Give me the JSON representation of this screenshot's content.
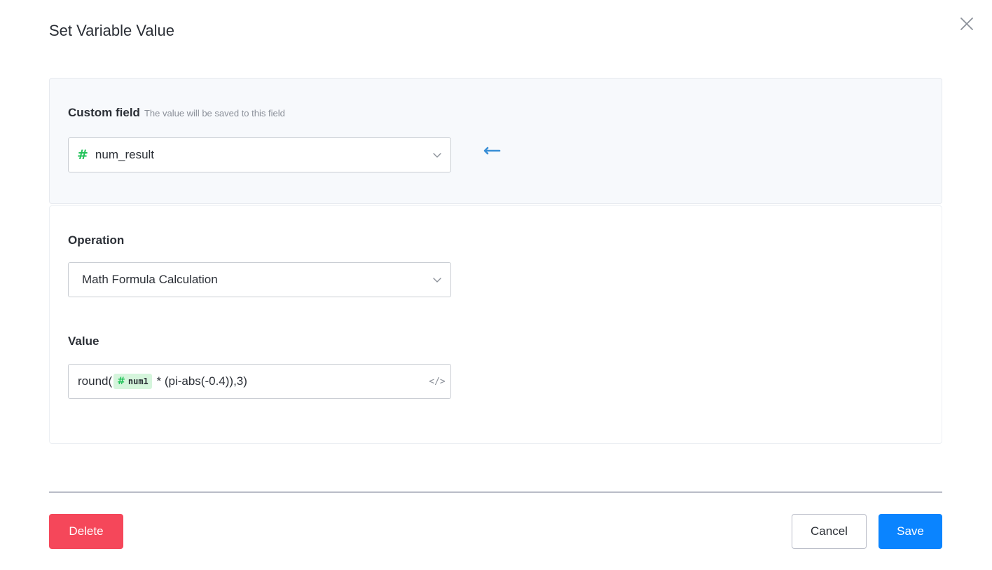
{
  "dialog": {
    "title": "Set Variable Value",
    "close_icon": "close-icon"
  },
  "custom_field": {
    "label": "Custom field",
    "hint": "The value will be saved to this field",
    "selected": "num_result",
    "type_icon": "hash-icon",
    "assign_icon": "arrow-left-icon"
  },
  "operation": {
    "label": "Operation",
    "selected": "Math Formula Calculation"
  },
  "value": {
    "label": "Value",
    "prefix": "round(",
    "variable": "num1",
    "suffix": " * (pi-abs(-0.4)),3)",
    "code_icon": "code-icon",
    "code_glyph": "</>"
  },
  "footer": {
    "delete_label": "Delete",
    "cancel_label": "Cancel",
    "save_label": "Save"
  },
  "colors": {
    "accent": "#0a84ff",
    "danger": "#f5475a",
    "variable": "#22c35a",
    "variable_chip_bg": "#d5f5dc",
    "assign_arrow": "#3a8fd6"
  }
}
